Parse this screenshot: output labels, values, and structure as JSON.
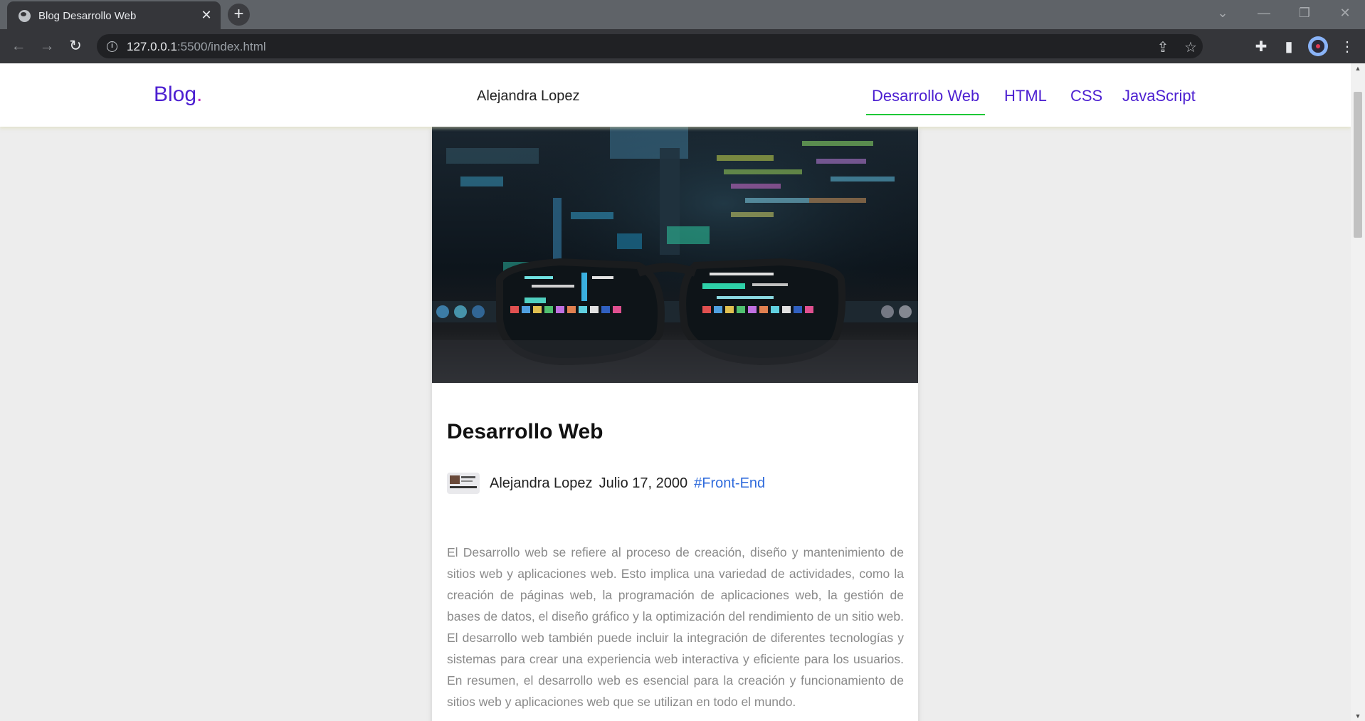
{
  "browser": {
    "tab_title": "Blog Desarrollo Web",
    "url_host": "127.0.0.1",
    "url_path": ":5500/index.html",
    "icons": {
      "favicon": "globe-icon",
      "close": "close-icon",
      "new_tab": "plus-icon",
      "back": "arrow-left-icon",
      "forward": "arrow-right-icon",
      "reload": "reload-icon",
      "share": "share-icon",
      "bookmark": "star-icon",
      "extensions": "puzzle-icon",
      "side_panel": "side-panel-icon",
      "menu": "kebab-menu-icon"
    }
  },
  "header": {
    "logo": "Blog",
    "logo_dot": ".",
    "author": "Alejandra Lopez",
    "nav": [
      "Desarrollo Web",
      "HTML",
      "CSS",
      "JavaScript"
    ],
    "active_nav": "Desarrollo Web"
  },
  "post": {
    "title": "Desarrollo Web",
    "author": "Alejandra Lopez",
    "date": "Julio 17, 2000",
    "tag": "#Front-End",
    "body": "El Desarrollo web se refiere al proceso de creación, diseño y mantenimiento de sitios web y aplicaciones web. Esto implica una variedad de actividades, como la creación de páginas web, la programación de aplicaciones web, la gestión de bases de datos, el diseño gráfico y la optimización del rendimiento de un sitio web. El desarrollo web también puede incluir la integración de diferentes tecnologías y sistemas para crear una experiencia web interactiva y eficiente para los usuarios. En resumen, el desarrollo web es esencial para la creación y funcionamiento de sitios web y aplicaciones web que se utilizan en todo el mundo."
  },
  "colors": {
    "accent": "#4c1fd1",
    "active_underline": "#1ec837",
    "tag": "#2f6bdc",
    "body_text": "#8a8a8a",
    "page_bg": "#ededed"
  }
}
